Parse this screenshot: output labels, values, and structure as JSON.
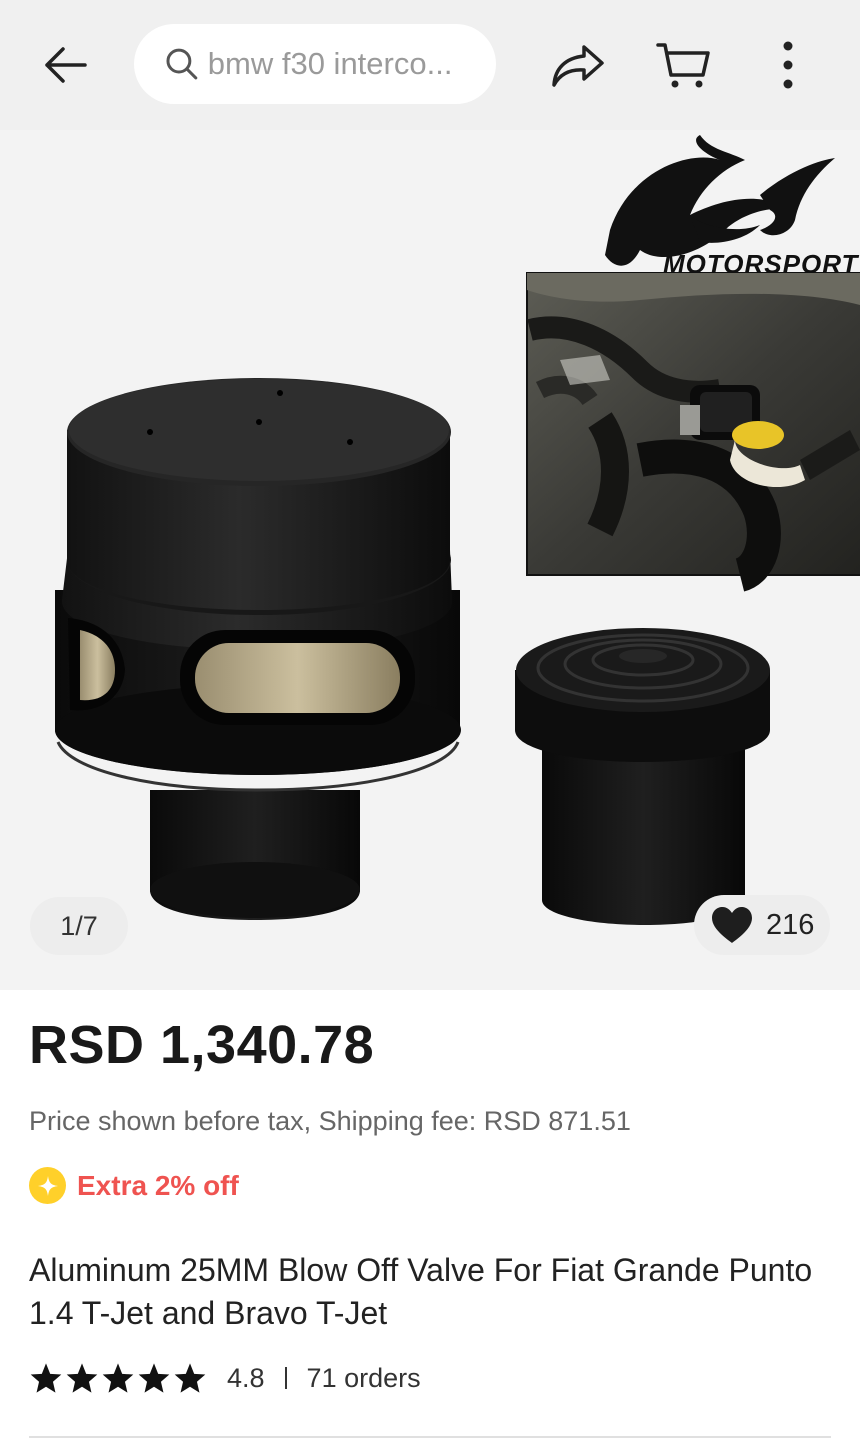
{
  "header": {
    "search_text": "bmw f30 interco..."
  },
  "gallery": {
    "brand_logo_text": "MOTORSPORT",
    "counter": "1/7",
    "wishlist_count": "216"
  },
  "product": {
    "price": "RSD 1,340.78",
    "tax_note": "Price shown before tax, Shipping fee: RSD 871.51",
    "promo": "Extra 2% off",
    "title": "Aluminum 25MM Blow Off Valve For Fiat Grande Punto 1.4 T-Jet and Bravo T-Jet",
    "rating": "4.8",
    "stars": 5,
    "orders": "71 orders"
  },
  "colors": {
    "promo_red": "#ef5350",
    "coin_yellow": "#ffd02a"
  }
}
